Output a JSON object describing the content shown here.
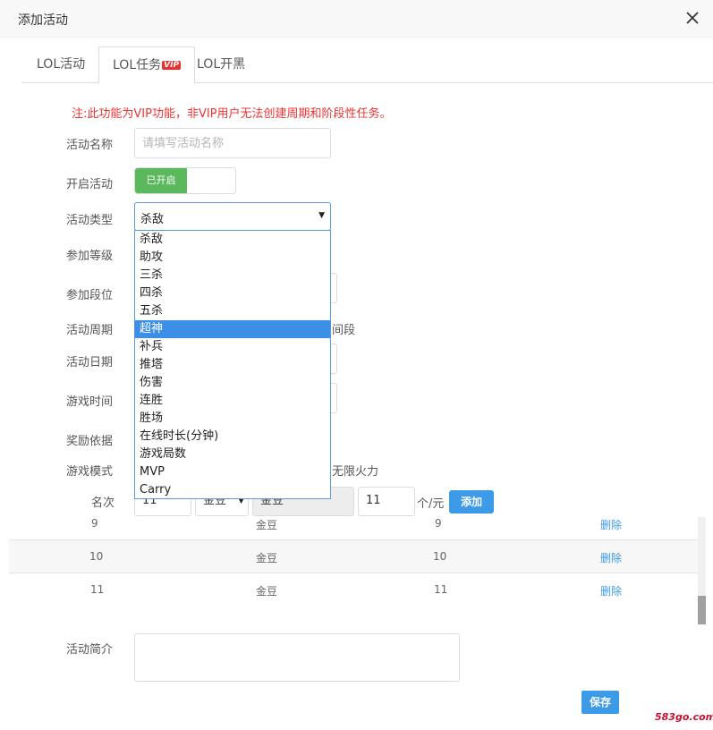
{
  "modal": {
    "title": "添加活动"
  },
  "tabs": [
    {
      "label": "LOL活动"
    },
    {
      "label": "LOL任务",
      "badge": "VIP"
    },
    {
      "label": "LOL开黑"
    }
  ],
  "notice": "注:此功能为VIP功能，非VIP用户无法创建周期和阶段性任务。",
  "form": {
    "labels": {
      "name": "活动名称",
      "enable": "开启活动",
      "type": "活动类型",
      "level": "参加等级",
      "rank": "参加段位",
      "period": "活动周期",
      "date": "活动日期",
      "game_time": "游戏时间",
      "reward_basis": "奖励依据",
      "game_mode": "游戏模式",
      "placement": "名次",
      "intro": "活动简介"
    },
    "name_placeholder": "请填写活动名称",
    "toggle_label": "已开启",
    "type_value": "杀敌",
    "period_partial": "间段",
    "mode_partial": "无限火力"
  },
  "dropdown": {
    "options": [
      "杀敌",
      "助攻",
      "三杀",
      "四杀",
      "五杀",
      "超神",
      "补兵",
      "推塔",
      "伤害",
      "连胜",
      "胜场",
      "在线时长(分钟)",
      "游戏局数",
      "MVP",
      "Carry"
    ],
    "selected_index": 5
  },
  "reward_row": {
    "rank_value": "11",
    "currency_select": "金豆",
    "currency_readonly": "金豆",
    "amount_value": "11",
    "unit": "个/元",
    "add_label": "添加"
  },
  "table": {
    "rows": [
      {
        "rank": "9",
        "currency": "金豆",
        "amount": "9",
        "action": "删除"
      },
      {
        "rank": "10",
        "currency": "金豆",
        "amount": "10",
        "action": "删除"
      },
      {
        "rank": "11",
        "currency": "金豆",
        "amount": "11",
        "action": "删除"
      }
    ]
  },
  "save_label": "保存",
  "watermark": "583go.com",
  "colors": {
    "accent": "#3c9ae6",
    "toggle_on": "#5cb85c",
    "notice": "#ee3333",
    "vip": "#e63232"
  }
}
